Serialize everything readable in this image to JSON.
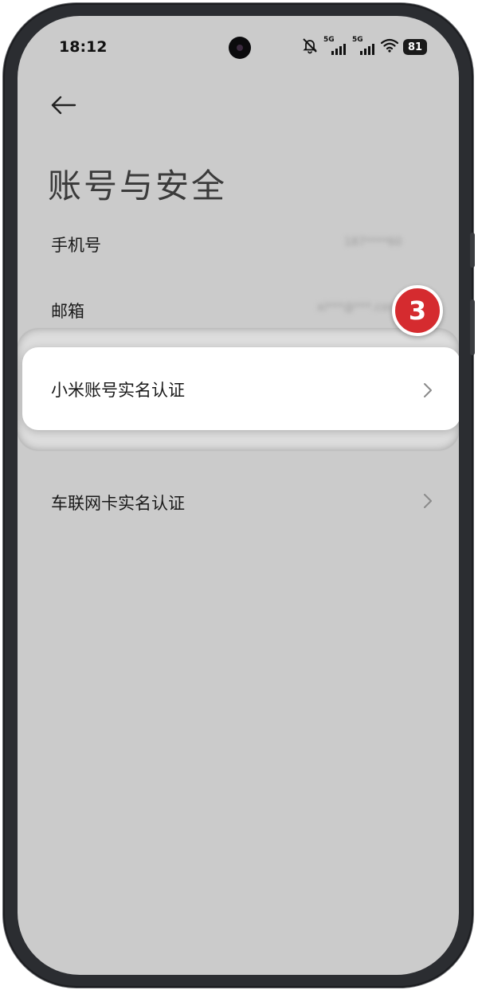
{
  "status_bar": {
    "time": "18:12",
    "signal_1_label": "5G",
    "signal_2_label": "5G",
    "battery": "81",
    "icons": [
      "bell-muted-icon",
      "signal-icon",
      "signal-icon",
      "wifi-icon",
      "battery-icon"
    ]
  },
  "header": {
    "back_icon": "arrow-left-icon",
    "title": "账号与安全"
  },
  "rows": [
    {
      "label": "手机号",
      "value": "187****60"
    },
    {
      "label": "邮箱",
      "value": "xi***@***.com"
    },
    {
      "label": "小米账号实名认证",
      "chevron": "chevron-right-icon"
    },
    {
      "label": "车联网卡实名认证",
      "chevron": "chevron-right-icon"
    }
  ],
  "step_badge": "3",
  "colors": {
    "screen_bg": "#cbcbcb",
    "card_bg": "#ffffff",
    "badge": "#d52b2f",
    "frame": "#2b2d31"
  }
}
